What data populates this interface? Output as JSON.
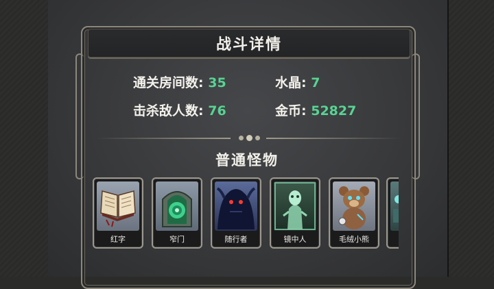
{
  "panel": {
    "title": "战斗详情",
    "stats": {
      "rooms_label": "通关房间数:",
      "rooms_value": "35",
      "crystal_label": "水晶:",
      "crystal_value": "7",
      "kills_label": "击杀敌人数:",
      "kills_value": "76",
      "gold_label": "金币:",
      "gold_value": "52827"
    },
    "section_title": "普通怪物",
    "monsters": [
      {
        "name": "红字",
        "icon": "open-book-icon"
      },
      {
        "name": "窄门",
        "icon": "portal-door-icon"
      },
      {
        "name": "随行者",
        "icon": "shadow-beast-icon"
      },
      {
        "name": "镜中人",
        "icon": "ghost-figure-icon"
      },
      {
        "name": "毛绒小熊",
        "icon": "teddy-bear-icon"
      },
      {
        "name": "",
        "icon": "partial-card-icon"
      }
    ]
  },
  "colors": {
    "accent_value": "#57d493",
    "text": "#f4f2ec",
    "frame": "#8d887c"
  }
}
